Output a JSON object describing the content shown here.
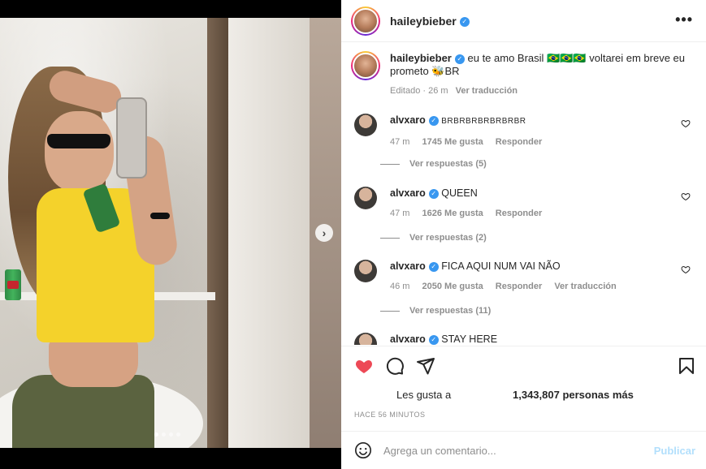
{
  "post": {
    "username": "haileybieber",
    "caption_username": "haileybieber",
    "caption_text": "eu te amo Brasil 🇧🇷🇧🇷🇧🇷 voltarei em breve eu prometo 🐝BR",
    "edited": "Editado · 26 m",
    "see_translation": "Ver traducción",
    "more_label": "•••",
    "next_label": "›"
  },
  "comments": [
    {
      "user": "alvxaro",
      "text": "BRBRBRBRBRBRBR",
      "time": "47 m",
      "likes": "1745 Me gusta",
      "reply": "Responder",
      "translation": "",
      "replies": "Ver respuestas (5)"
    },
    {
      "user": "alvxaro",
      "text": "QUEEN",
      "time": "47 m",
      "likes": "1626 Me gusta",
      "reply": "Responder",
      "translation": "",
      "replies": "Ver respuestas (2)"
    },
    {
      "user": "alvxaro",
      "text": "FICA AQUI NUM VAI NÃO",
      "time": "46 m",
      "likes": "2050 Me gusta",
      "reply": "Responder",
      "translation": "Ver traducción",
      "replies": "Ver respuestas (11)"
    },
    {
      "user": "alvxaro",
      "text": "STAY HERE",
      "time": "",
      "likes": "",
      "reply": "",
      "translation": "",
      "replies": ""
    }
  ],
  "actions": {
    "liked_by_prefix": "Les gusta a",
    "liked_by_count": "1,343,807 personas más",
    "timestamp": "HACE 56 MINUTOS"
  },
  "comment_box": {
    "placeholder": "Agrega un comentario...",
    "publish": "Publicar"
  },
  "carousel": {
    "total": 4,
    "active": 1
  },
  "colors": {
    "accent": "#3897f0",
    "heart": "#ed4956",
    "publish_disabled": "#b2dffc"
  },
  "icons": [
    "heart-icon",
    "comment-icon",
    "share-icon",
    "bookmark-icon",
    "emoji-icon",
    "verified-icon",
    "more-icon",
    "chevron-right-icon"
  ]
}
